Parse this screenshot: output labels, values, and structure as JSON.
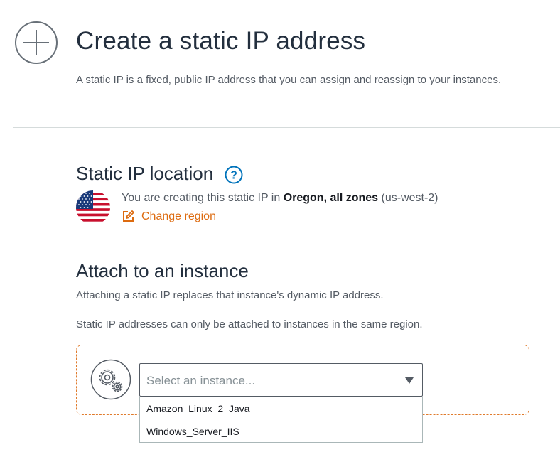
{
  "header": {
    "title": "Create a static IP address",
    "description": "A static IP is a fixed, public IP address that you can assign and reassign to your instances.",
    "icon": "add-circle-icon"
  },
  "location": {
    "title": "Static IP location",
    "help_icon": "help-icon",
    "flag_icon": "us-flag-icon",
    "text_prefix": "You are creating this static IP in ",
    "region_name": "Oregon, all zones",
    "region_code": " (us-west-2)",
    "change_region_label": "Change region",
    "change_region_icon": "edit-icon",
    "accent_color": "#dd6b10"
  },
  "attach": {
    "title": "Attach to an instance",
    "paragraph_1": "Attaching a static IP replaces that instance's dynamic IP address.",
    "paragraph_2": "Static IP addresses can only be attached to instances in the same region.",
    "instance_icon": "gears-icon",
    "select": {
      "placeholder": "Select an instance...",
      "options": [
        "Amazon_Linux_2_Java",
        "Windows_Server_IIS"
      ]
    },
    "box_border_color": "#e07b2c"
  }
}
